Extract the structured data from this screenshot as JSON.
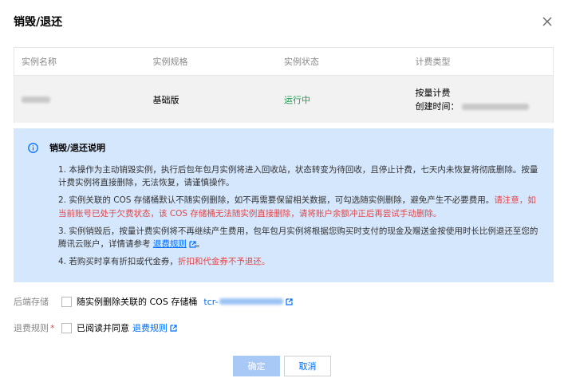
{
  "dialog": {
    "title": "销毁/退还"
  },
  "table": {
    "headers": [
      "实例名称",
      "实例规格",
      "实例状态",
      "计费类型"
    ],
    "row": {
      "spec": "基础版",
      "status": "运行中",
      "billing_type": "按量计费",
      "created_label": "创建时间："
    }
  },
  "info": {
    "title": "销毁/退还说明",
    "items": [
      {
        "prefix": "1.",
        "text": "本操作为主动销毁实例，执行后包年包月实例将进入回收站，状态转变为待回收，且停止计费，七天内未恢复将彻底删除。按量计费实例将直接删除，无法恢复，请谨慎操作。"
      },
      {
        "prefix": "2.",
        "text": "实例关联的 COS 存储桶默认不随实例删除，如不再需要保留相关数据，可勾选随实例删除，避免产生不必要费用。",
        "red": "请注意，如当前账号已处于欠费状态，该 COS 存储桶无法随实例直接删除，请将账户余额冲正后再尝试手动删除。"
      },
      {
        "prefix": "3.",
        "text": "实例销毁后，按量计费实例将不再继续产生费用，包年包月实例将根据您购买时支付的现金及赠送金按使用时长比例退还至您的腾讯云账户，详情请参考",
        "link": "退费规则",
        "suffix": "。"
      },
      {
        "prefix": "4.",
        "text": "若购买时享有折扣或代金券，",
        "red": "折扣和代金券不予退还。"
      }
    ]
  },
  "form": {
    "storage_label": "后端存储",
    "storage_checkbox_text": "随实例删除关联的 COS 存储桶",
    "cos_prefix": "tcr-",
    "refund_label": "退费规则",
    "refund_checkbox_text": "已阅读并同意",
    "refund_link": "退费规则"
  },
  "buttons": {
    "ok": "确定",
    "cancel": "取消"
  }
}
